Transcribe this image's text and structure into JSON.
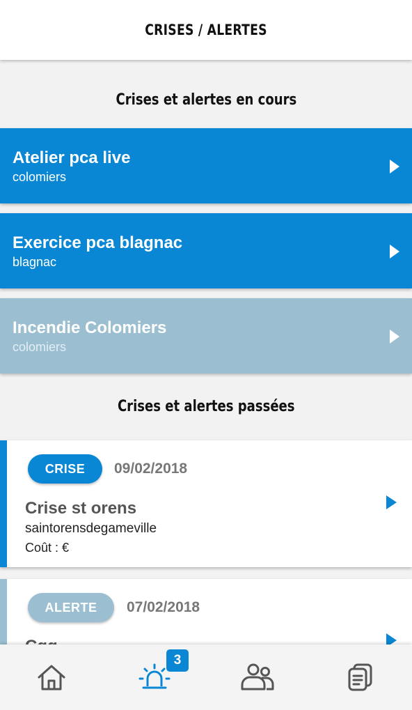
{
  "header": {
    "title": "CRISES / ALERTES"
  },
  "current_section": {
    "title": "Crises et alertes en cours",
    "items": [
      {
        "title": "Atelier pca live",
        "subtitle": "colomiers",
        "status": "active"
      },
      {
        "title": "Exercice pca blagnac",
        "subtitle": "blagnac",
        "status": "active"
      },
      {
        "title": "Incendie Colomiers",
        "subtitle": "colomiers",
        "status": "muted"
      }
    ]
  },
  "past_section": {
    "title": "Crises et alertes passées",
    "items": [
      {
        "badge": "CRISE",
        "date": "09/02/2018",
        "title": "Crise st orens",
        "place": "saintorensdegameville",
        "cost": "Coût : €"
      },
      {
        "badge": "ALERTE",
        "date": "07/02/2018",
        "title": "Cgg"
      }
    ]
  },
  "bottom_nav": {
    "items": [
      {
        "icon": "home-icon",
        "active": false
      },
      {
        "icon": "siren-icon",
        "active": true,
        "badge": "3"
      },
      {
        "icon": "people-icon",
        "active": false
      },
      {
        "icon": "documents-icon",
        "active": false
      }
    ]
  },
  "colors": {
    "accent": "#0a87d4",
    "muted_card": "#9bbfd1",
    "crise_badge": "#0a87d4",
    "alerte_badge": "#9bbfd1",
    "nav_icon": "#555555"
  }
}
